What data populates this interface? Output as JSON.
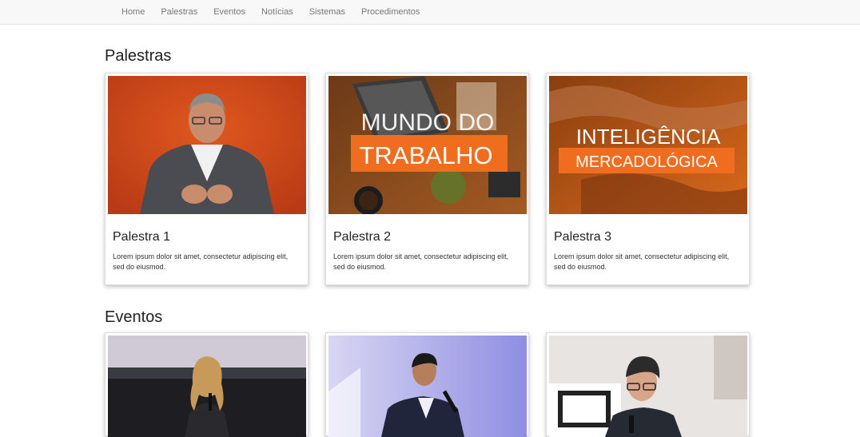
{
  "nav": {
    "items": [
      {
        "label": "Home"
      },
      {
        "label": "Palestras"
      },
      {
        "label": "Eventos"
      },
      {
        "label": "Notícias"
      },
      {
        "label": "Sistemas"
      },
      {
        "label": "Procedimentos"
      }
    ]
  },
  "palestras": {
    "heading": "Palestras",
    "cards": [
      {
        "title": "Palestra 1",
        "text": "Lorem ipsum dolor sit amet, consectetur adipiscing elit, sed do eiusmod."
      },
      {
        "title": "Palestra 2",
        "text": "Lorem ipsum dolor sit amet, consectetur adipiscing elit, sed do eiusmod.",
        "image_text": [
          "MUNDO DO",
          "TRABALHO"
        ]
      },
      {
        "title": "Palestra 3",
        "text": "Lorem ipsum dolor sit amet, consectetur adipiscing elit, sed do eiusmod.",
        "image_text": [
          "INTELIGÊNCIA",
          "MERCADOLÓGICA"
        ]
      }
    ]
  },
  "eventos": {
    "heading": "Eventos"
  },
  "colors": {
    "accent_orange": "#f06d1f",
    "navbar_bg": "#f8f8f8",
    "nav_text": "#777777"
  }
}
